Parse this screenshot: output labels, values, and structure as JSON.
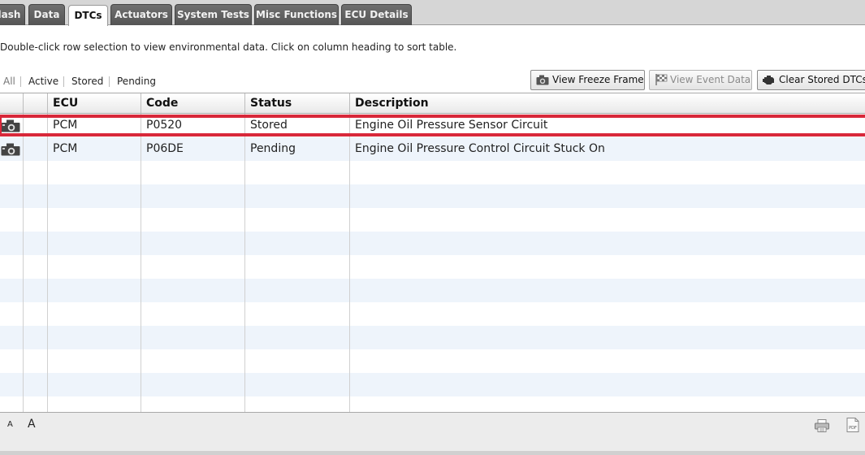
{
  "tabs": [
    {
      "label": "lash"
    },
    {
      "label": "Data"
    },
    {
      "label": "DTCs",
      "active": true
    },
    {
      "label": "Actuators"
    },
    {
      "label": "System Tests"
    },
    {
      "label": "Misc Functions"
    },
    {
      "label": "ECU Details"
    }
  ],
  "instructions": "Double-click row selection to view environmental data.  Click on column heading to sort table.",
  "filters": [
    "All",
    "Active",
    "Stored",
    "Pending"
  ],
  "buttons": {
    "freeze_frame": "View Freeze Frame",
    "event_data": "View Event Data",
    "clear_stored": "Clear Stored DTCs"
  },
  "columns": [
    "ECU",
    "Code",
    "Status",
    "Description"
  ],
  "rows": [
    {
      "ecu": "PCM",
      "code": "P0520",
      "status": "Stored",
      "description": "Engine Oil Pressure Sensor Circuit",
      "icon": "camera-icon",
      "highlighted": true
    },
    {
      "ecu": "PCM",
      "code": "P06DE",
      "status": "Pending",
      "description": "Engine Oil Pressure Control Circuit Stuck On",
      "icon": "camera-icon"
    }
  ],
  "footer": {
    "font_small": "A",
    "font_large": "A",
    "print_icon": "printer-icon",
    "pdf_icon": "pdf-icon",
    "pdf_label": "PDF"
  },
  "colors": {
    "highlight": "#d8283a",
    "tab_dark": "#555555",
    "row_alt": "#eef4fb"
  }
}
